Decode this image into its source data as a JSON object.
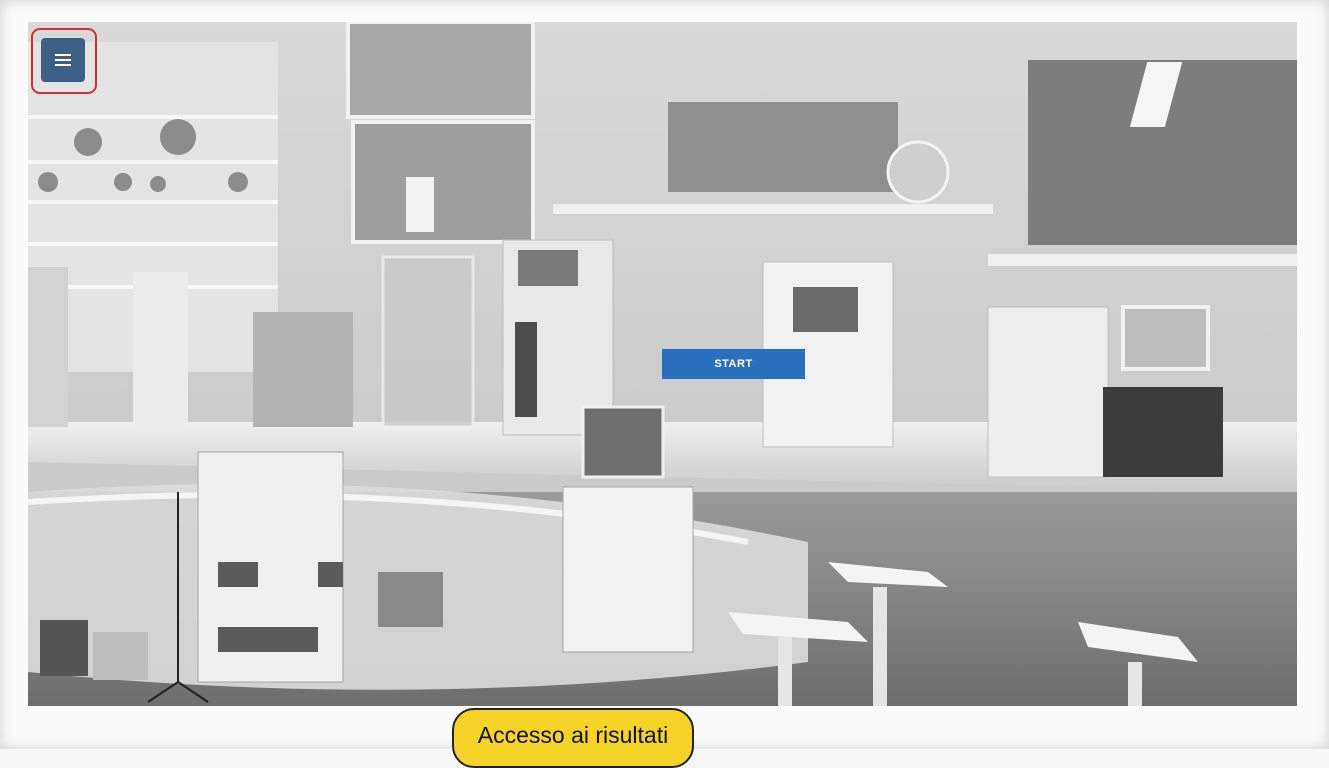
{
  "scene": {
    "icon": "laboratory-scene"
  },
  "menu": {
    "icon": "hamburger-menu-icon",
    "color": "#3c5f86",
    "highlight_color": "#cf2f2f"
  },
  "start_button": {
    "label": "START",
    "color": "#2a6fbd"
  },
  "results_button": {
    "label": "Accesso ai risultati",
    "color": "#f5d327"
  }
}
